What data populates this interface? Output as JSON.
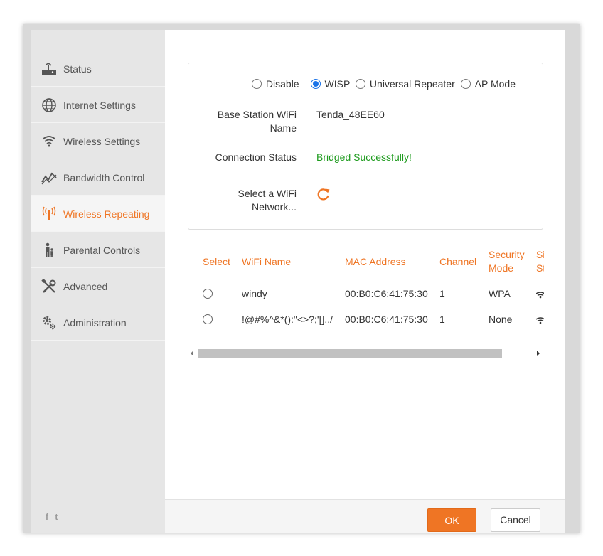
{
  "sidebar": {
    "items": [
      {
        "label": "Status",
        "icon": "router-icon"
      },
      {
        "label": "Internet Settings",
        "icon": "globe-icon"
      },
      {
        "label": "Wireless Settings",
        "icon": "wifi-icon"
      },
      {
        "label": "Bandwidth Control",
        "icon": "bandwidth-icon"
      },
      {
        "label": "Wireless Repeating",
        "icon": "repeater-icon",
        "active": true
      },
      {
        "label": "Parental Controls",
        "icon": "parental-icon"
      },
      {
        "label": "Advanced",
        "icon": "tools-icon"
      },
      {
        "label": "Administration",
        "icon": "gears-icon"
      }
    ],
    "social": [
      "f",
      "t"
    ]
  },
  "modes": {
    "options": [
      "Disable",
      "WISP",
      "Universal Repeater",
      "AP Mode"
    ],
    "selected": "WISP"
  },
  "fields": {
    "base_station_label": "Base Station WiFi Name",
    "base_station_value": "Tenda_48EE60",
    "connection_label": "Connection Status",
    "connection_value": "Bridged Successfully!",
    "select_wifi_label": "Select a WiFi Network..."
  },
  "table": {
    "headers": [
      "Select",
      "WiFi Name",
      "MAC Address",
      "Channel",
      "Security Mode",
      "Si St"
    ],
    "rows": [
      {
        "wifi_name": "windy",
        "mac": "00:B0:C6:41:75:30",
        "channel": "1",
        "security": "WPA"
      },
      {
        "wifi_name": "!@#%^&*():\"<>?;'[],./",
        "mac": "00:B0:C6:41:75:30",
        "channel": "1",
        "security": "None"
      }
    ]
  },
  "footer": {
    "ok_label": "OK",
    "cancel_label": "Cancel"
  },
  "colors": {
    "accent": "#ef7524",
    "success": "#1e9b1e",
    "radio_checked": "#1a73e8"
  }
}
